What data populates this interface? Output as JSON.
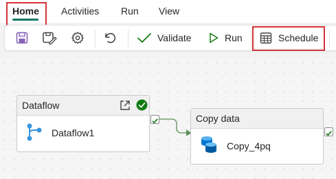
{
  "menu": {
    "tabs": [
      {
        "label": "Home",
        "active": true
      },
      {
        "label": "Activities"
      },
      {
        "label": "Run"
      },
      {
        "label": "View"
      }
    ]
  },
  "toolbar": {
    "validate_label": "Validate",
    "run_label": "Run",
    "schedule_label": "Schedule"
  },
  "canvas": {
    "nodes": [
      {
        "title": "Dataflow",
        "name": "Dataflow1",
        "status": "succeeded"
      },
      {
        "title": "Copy data",
        "name": "Copy_4pq"
      }
    ]
  },
  "colors": {
    "accent": "#117865",
    "highlight_box": "#d13438",
    "success": "#107c10",
    "save_icon": "#8764b8",
    "dataflow_icon": "#3a96dd",
    "copy_icon": "#0078d4"
  }
}
